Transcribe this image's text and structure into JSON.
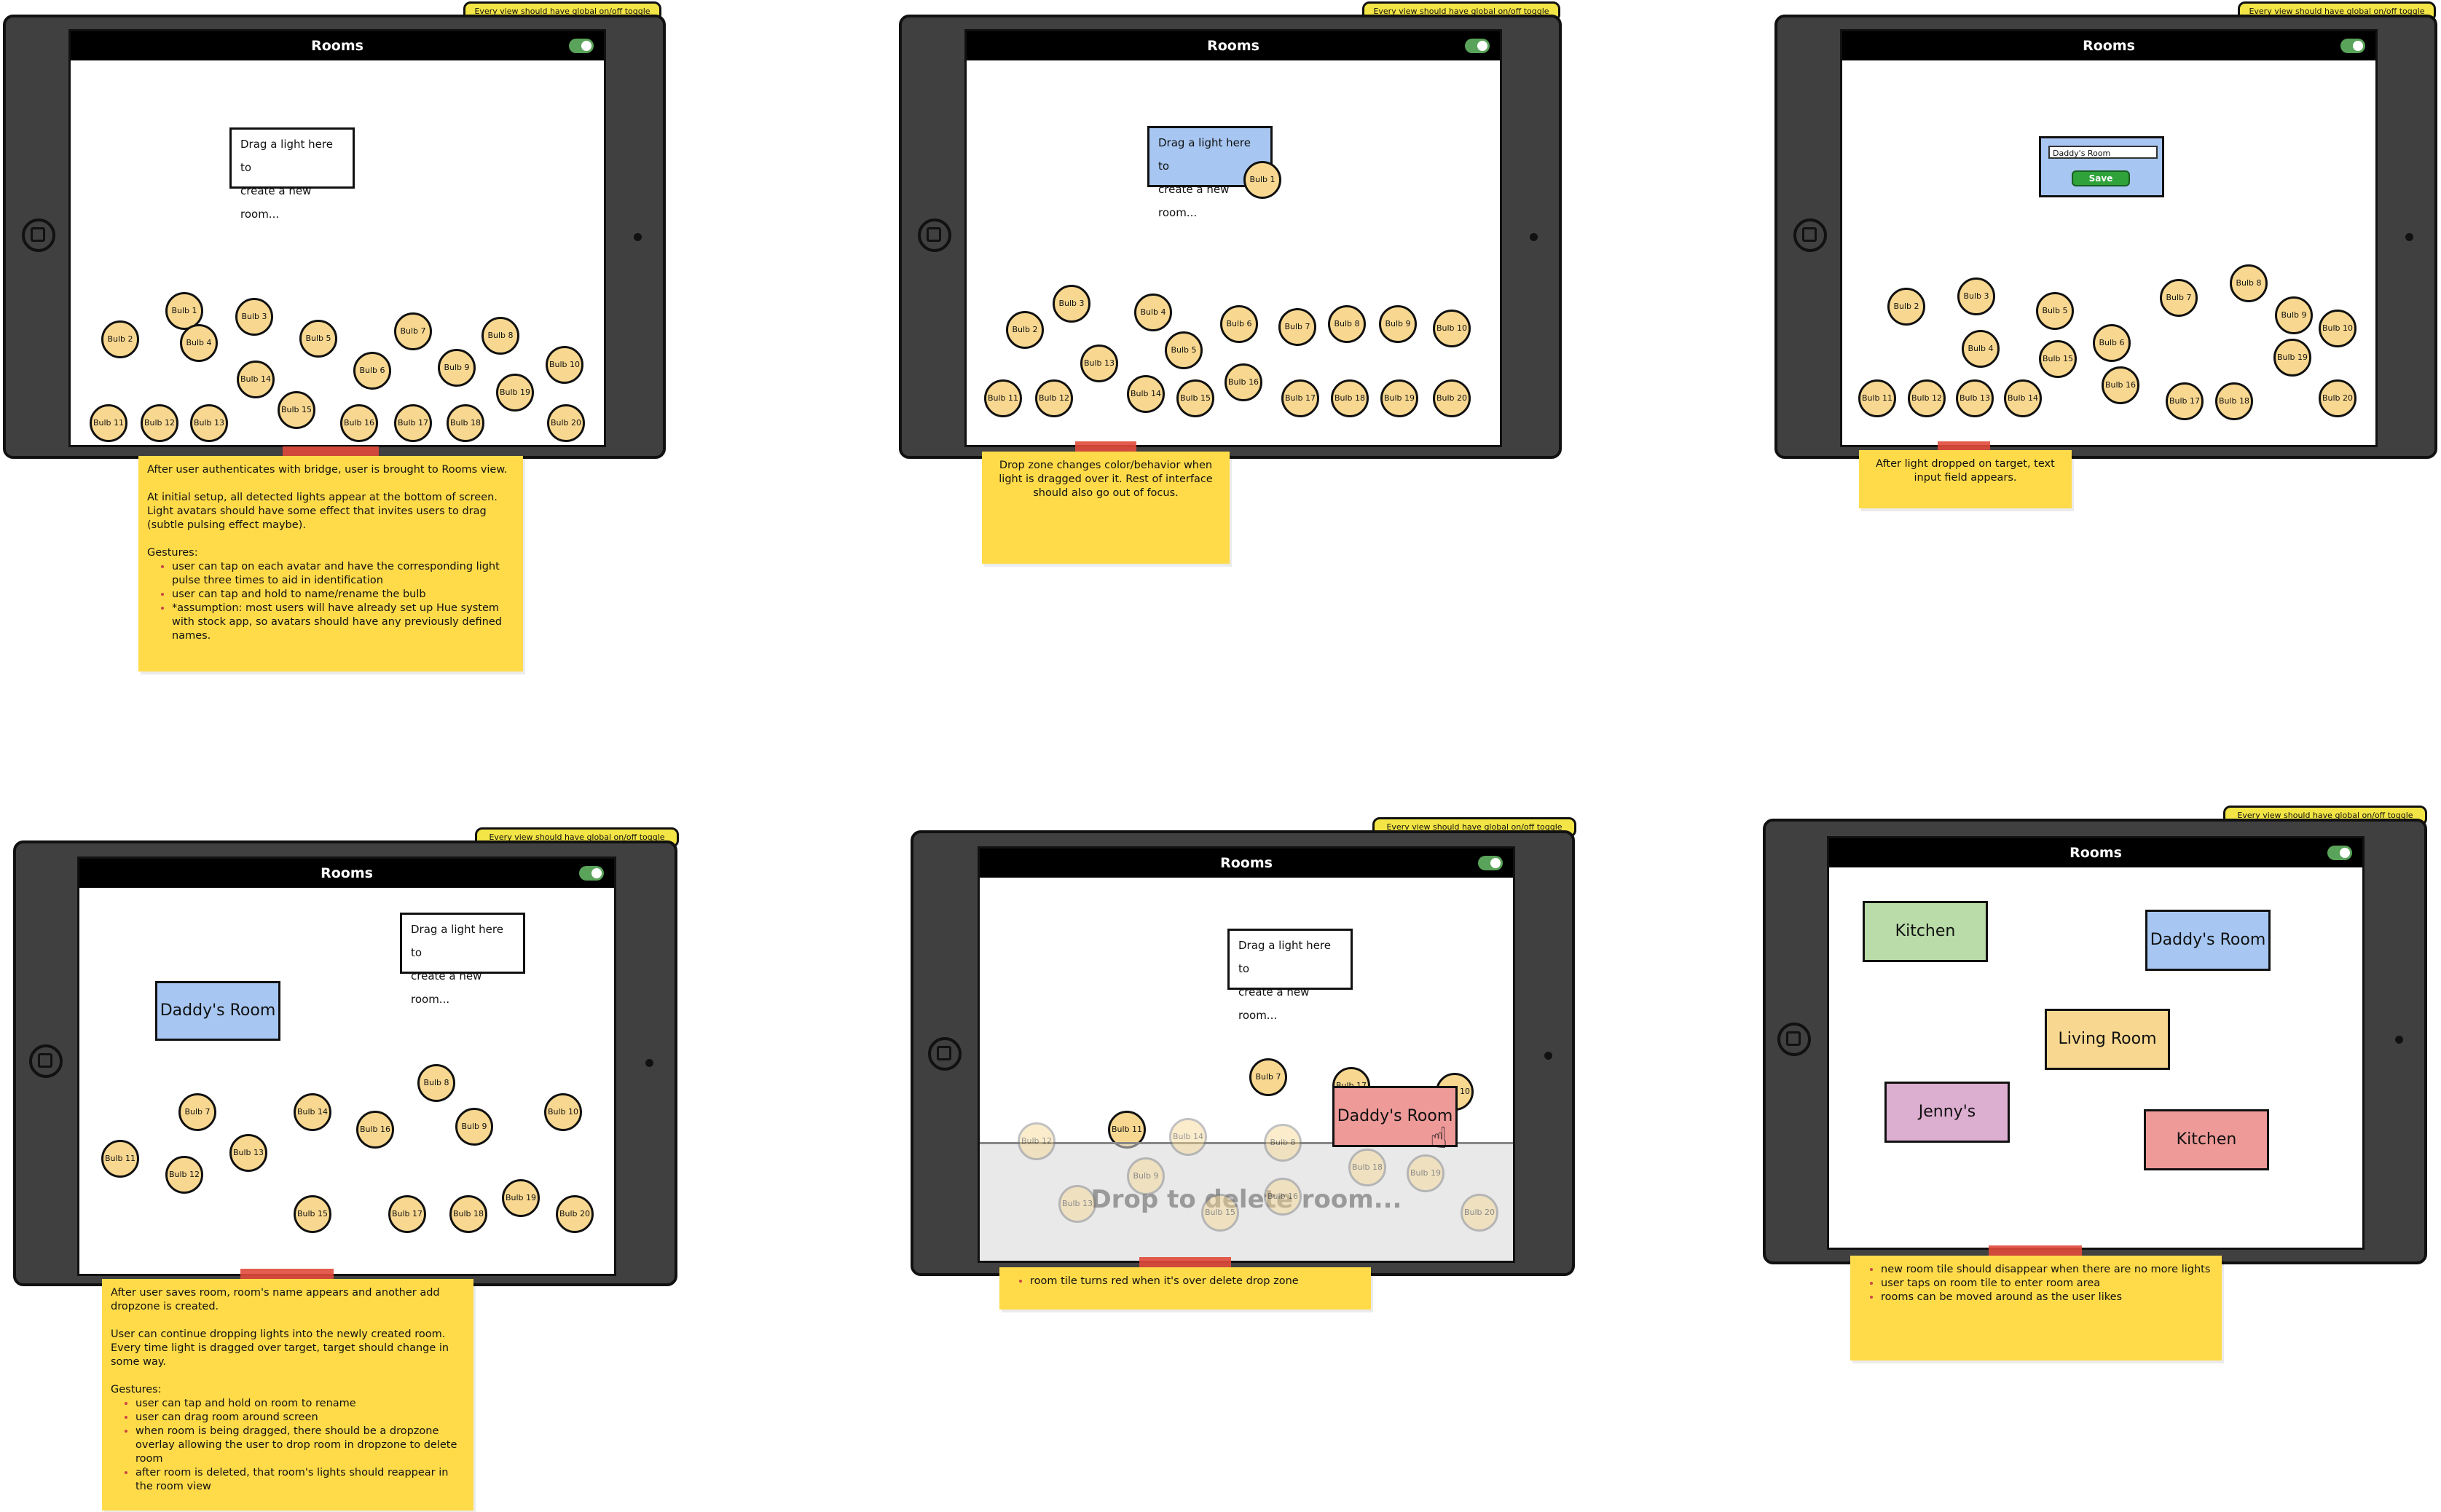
{
  "common": {
    "banner": "Every view should have global on/off toggle",
    "title": "Rooms",
    "dropzone": "Drag a light here to\ncreate a new room..."
  },
  "panel1": {
    "bulbs": [
      "Bulb 1",
      "Bulb 2",
      "Bulb 3",
      "Bulb 4",
      "Bulb 5",
      "Bulb 6",
      "Bulb 7",
      "Bulb 8",
      "Bulb 9",
      "Bulb 10",
      "Bulb 11",
      "Bulb 12",
      "Bulb 13",
      "Bulb 14",
      "Bulb 15",
      "Bulb 16",
      "Bulb 17",
      "Bulb 18",
      "Bulb 19",
      "Bulb 20"
    ],
    "note": {
      "p1": "After user authenticates with bridge, user is brought to Rooms view.",
      "p2": "At initial setup, all detected lights appear at the bottom of screen.\nLight avatars should have some effect that invites users to drag\n(subtle pulsing effect maybe).",
      "gestures_label": "Gestures:",
      "bullets": [
        "user can tap on each avatar and have the corresponding light pulse three times to aid in identification",
        "user can tap and hold to name/rename the bulb",
        "*assumption: most users will have already set up Hue system with stock app, so avatars should have any previously defined names."
      ]
    }
  },
  "panel2": {
    "dragged_bulb": "Bulb 1",
    "bulbs": [
      "Bulb 2",
      "Bulb 3",
      "Bulb 4",
      "Bulb 5",
      "Bulb 6",
      "Bulb 7",
      "Bulb 8",
      "Bulb 9",
      "Bulb 10",
      "Bulb 11",
      "Bulb 12",
      "Bulb 13",
      "Bulb 14",
      "Bulb 15",
      "Bulb 16",
      "Bulb 17",
      "Bulb 18",
      "Bulb 19",
      "Bulb 20"
    ],
    "note": "Drop zone changes color/behavior when light is dragged over it. Rest of interface should also go out of focus."
  },
  "panel3": {
    "input_value": "Daddy's Room",
    "save_label": "Save",
    "bulbs": [
      "Bulb 2",
      "Bulb 3",
      "Bulb 4",
      "Bulb 5",
      "Bulb 6",
      "Bulb 7",
      "Bulb 8",
      "Bulb 9",
      "Bulb 10",
      "Bulb 11",
      "Bulb 12",
      "Bulb 13",
      "Bulb 14",
      "Bulb 15",
      "Bulb 16",
      "Bulb 17",
      "Bulb 18",
      "Bulb 19",
      "Bulb 20"
    ],
    "note": "After light dropped on target, text input field appears."
  },
  "panel4": {
    "room": "Daddy's Room",
    "room_color": "#a7c7f2",
    "bulbs": [
      "Bulb 7",
      "Bulb 8",
      "Bulb 9",
      "Bulb 10",
      "Bulb 11",
      "Bulb 12",
      "Bulb 13",
      "Bulb 14",
      "Bulb 15",
      "Bulb 16",
      "Bulb 17",
      "Bulb 18",
      "Bulb 19",
      "Bulb 20"
    ],
    "note": {
      "p1": "After user saves room, room's name appears and another add dropzone is created.",
      "p2": "User can continue dropping lights into the newly created room.\nEvery time light is dragged over target, target should change in some way.",
      "gestures_label": "Gestures:",
      "bullets": [
        "user can tap and hold on room to rename",
        "user can drag room around screen",
        "when room is being dragged, there should be a dropzone overlay allowing the user to drop room in dropzone to delete room",
        "after room is deleted, that room's lights should reappear in the room view"
      ]
    }
  },
  "panel5": {
    "room": "Daddy's Room",
    "room_color": "#ee9a98",
    "delete_text": "Drop to delete room...",
    "bulbs": [
      "Bulb 7",
      "Bulb 17",
      "Bulb 10",
      "Bulb 11",
      "Bulb 12",
      "Bulb 14",
      "Bulb 8",
      "Bulb 9",
      "Bulb 18",
      "Bulb 19",
      "Bulb 13",
      "Bulb 15",
      "Bulb 16",
      "Bulb 20"
    ],
    "note": "room tile turns red when it's over delete drop zone"
  },
  "panel6": {
    "rooms": [
      {
        "name": "Kitchen",
        "color": "#b9dca8"
      },
      {
        "name": "Daddy's Room",
        "color": "#a7c7f2"
      },
      {
        "name": "Living Room",
        "color": "#f8d890"
      },
      {
        "name": "Jenny's",
        "color": "#dcaed0"
      },
      {
        "name": "Kitchen",
        "color": "#ee9a98"
      }
    ],
    "note_bullets": [
      "new room tile should disappear when there are no more lights",
      "user taps on room tile to enter room area",
      "rooms can be moved around as the user likes"
    ]
  }
}
